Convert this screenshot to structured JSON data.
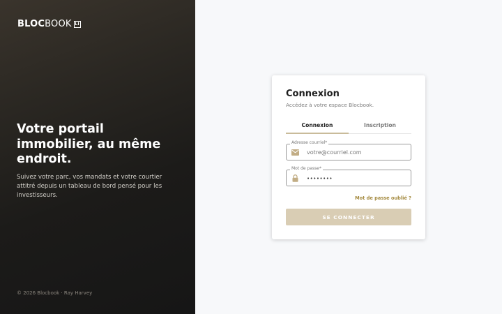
{
  "brand": {
    "name_bold": "BLOC",
    "name_light": "BOOK",
    "badge": "LI"
  },
  "hero": {
    "title": "Votre portail immobilier, au même endroit.",
    "description": "Suivez votre parc, vos mandats et votre courtier attitré depuis un tableau de bord pensé pour les investisseurs."
  },
  "footer": {
    "text": "© 2026 Blocbook · Ray Harvey"
  },
  "login": {
    "title": "Connexion",
    "subtitle": "Accédez à votre espace Blocbook.",
    "tabs": [
      {
        "label": "Connexion",
        "active": true
      },
      {
        "label": "Inscription",
        "active": false
      }
    ],
    "email": {
      "label": "Adresse courriel*",
      "placeholder": "votre@courriel.com",
      "value": "",
      "icon": "mail-icon"
    },
    "password": {
      "label": "Mot de passe*",
      "value": "••••••••",
      "icon": "lock-icon"
    },
    "forgot_link": "Mot de passe oublié ?",
    "submit_label": "SE CONNECTER"
  },
  "colors": {
    "accent_gold": "#c9bb9a",
    "button_disabled": "#d9cdb4",
    "link_gold": "#a48a3f",
    "dark_panel": "#1c1b19"
  }
}
